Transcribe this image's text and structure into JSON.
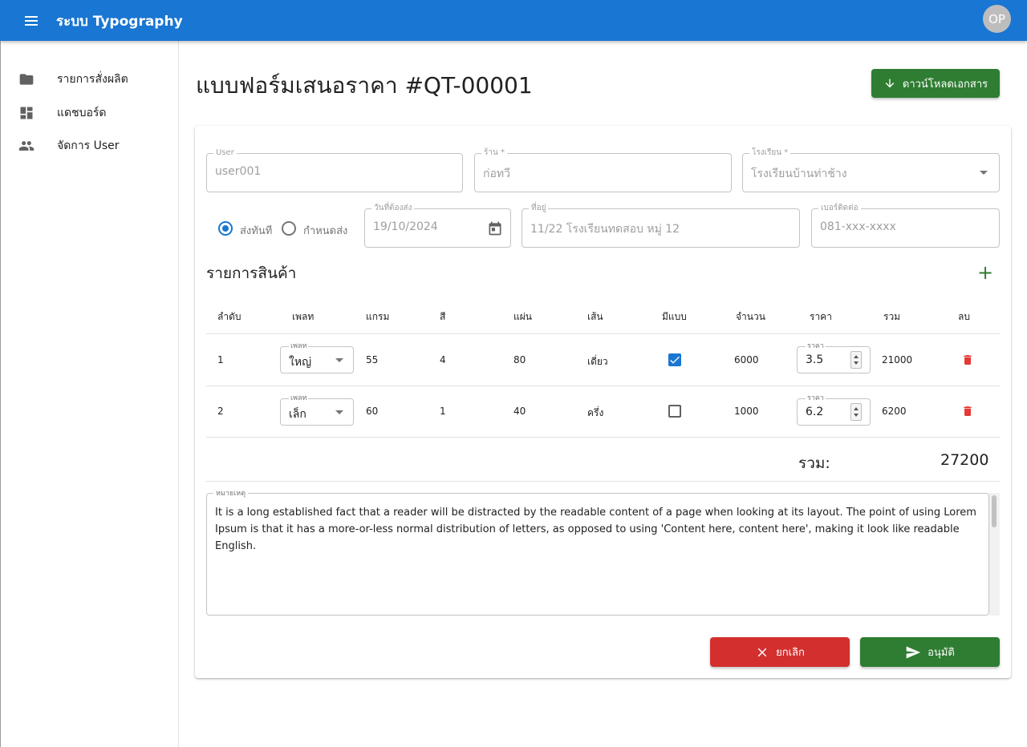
{
  "appbar": {
    "title": "ระบบ Typography",
    "avatar_initials": "OP",
    "color": "#1976d2"
  },
  "sidebar": {
    "items": [
      {
        "label": "รายการสั่งผลิต",
        "icon": "folder-icon"
      },
      {
        "label": "แดชบอร์ด",
        "icon": "dashboard-icon"
      },
      {
        "label": "จัดการ User",
        "icon": "people-icon"
      }
    ]
  },
  "header": {
    "title": "แบบฟอร์มเสนอราคา #QT-00001",
    "download_label": "ดาวน์โหลดเอกสาร"
  },
  "form": {
    "user": {
      "label": "User",
      "value": "user001"
    },
    "shop": {
      "label": "ร้าน *",
      "value": "ก่อทวี"
    },
    "school": {
      "label": "โรงเรียน *",
      "value": "โรงเรียนบ้านท่าช้าง"
    },
    "delivery_options": [
      {
        "label": "ส่งทันที",
        "selected": true
      },
      {
        "label": "กำหนดส่ง",
        "selected": false
      }
    ],
    "due_date": {
      "label": "วันที่ต้องส่ง",
      "value": "19/10/2024"
    },
    "address": {
      "label": "ที่อยู่",
      "value": "11/22 โรงเรียนทดสอบ หมู่ 12"
    },
    "phone": {
      "label": "เบอร์ติดต่อ",
      "value": "081-xxx-xxxx"
    }
  },
  "products": {
    "title": "รายการสินค้า",
    "headers": [
      "ลำดับ",
      "เพลท",
      "แกรม",
      "สี",
      "แผ่น",
      "เส้น",
      "มีแบบ",
      "จำนวน",
      "ราคา",
      "รวม",
      "ลบ"
    ],
    "plate_label": "เพลท",
    "price_label": "ราคา",
    "rows": [
      {
        "no": "1",
        "plate": "ใหญ่",
        "gram": "55",
        "color": "4",
        "sheets": "80",
        "line": "เดี่ยว",
        "has_pattern": true,
        "qty": "6000",
        "price": "3.5",
        "total": "21000"
      },
      {
        "no": "2",
        "plate": "เล็ก",
        "gram": "60",
        "color": "1",
        "sheets": "40",
        "line": "ครึ่ง",
        "has_pattern": false,
        "qty": "1000",
        "price": "6.2",
        "total": "6200"
      }
    ],
    "sum_label": "รวม:",
    "sum_value": "27200"
  },
  "notes": {
    "label": "หมายเหตุ",
    "text": "It is a long established fact that a reader will be distracted by the readable content of a page when looking at its layout. The point of using Lorem Ipsum is that it has a more-or-less normal distribution of letters, as opposed to using 'Content here, content here', making it look like readable English."
  },
  "actions": {
    "cancel_label": "ยกเลิก",
    "approve_label": "อนุมัติ",
    "cancel_color": "#d32f2f",
    "approve_color": "#2e7d32"
  }
}
